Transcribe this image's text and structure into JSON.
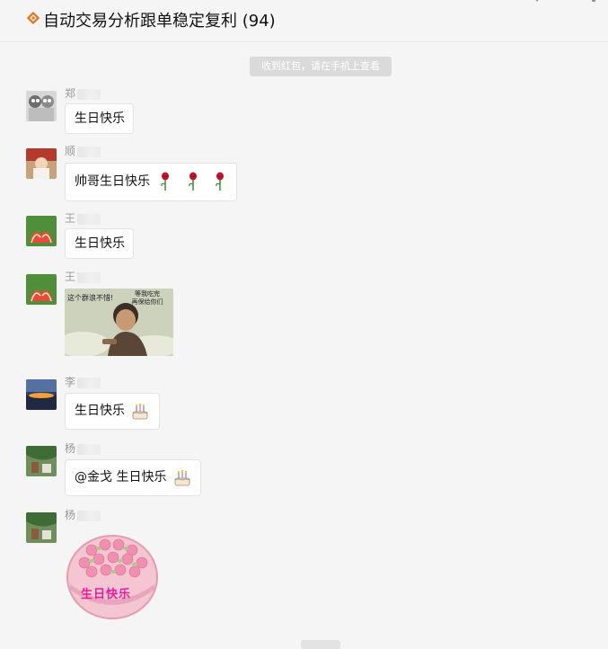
{
  "header": {
    "title": "自动交易分析跟单稳定复利 (94)",
    "group_icon": "group-badge-icon"
  },
  "system_notice": "收到红包，请在手机上查看",
  "messages": [
    {
      "sender": "郑",
      "text": "生日快乐",
      "avatar": "avatar-icon"
    },
    {
      "sender": "顺",
      "text": "帅哥生日快乐",
      "emoji": "rose-icon"
    },
    {
      "sender": "王",
      "text": "生日快乐",
      "avatar": "avatar-icon"
    },
    {
      "sender": "王",
      "image_caption_left": "这个群浪不惜!",
      "image_caption_right": "等我吃完\n再保给你们"
    },
    {
      "sender": "李",
      "text": "生日快乐",
      "emoji": "cake-icon"
    },
    {
      "sender": "杨",
      "text": "@金戈 生日快乐",
      "emoji": "cake-icon"
    },
    {
      "sender": "杨",
      "sticker_text": "生日快乐"
    }
  ],
  "colors": {
    "background": "#f5f5f5",
    "bubble": "#ffffff",
    "accent_badge": "#e8711c",
    "sticker_text": "#e81e9a"
  }
}
